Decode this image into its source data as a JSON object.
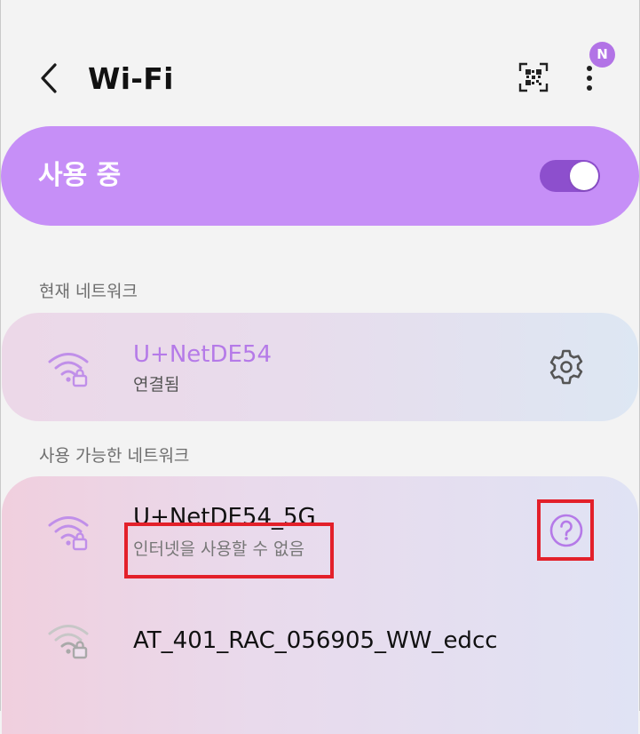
{
  "header": {
    "title": "Wi-Fi",
    "back_icon": "chevron-left-icon",
    "qr_icon": "qr-code-scan-icon",
    "more_icon": "more-vertical-icon",
    "avatar_initial": "N",
    "avatar_color": "#b273e6"
  },
  "master_toggle": {
    "label": "사용 중",
    "state": "on",
    "card_color": "#c68ff7",
    "track_color": "#8d4fcd"
  },
  "current_network": {
    "section_label": "현재 네트워크",
    "name": "U+NetDE54",
    "status": "연결됨",
    "name_color": "#b57ae8",
    "action_icon": "gear-icon"
  },
  "available_networks": {
    "section_label": "사용 가능한 네트워크",
    "items": [
      {
        "name": "U+NetDE54_5G",
        "status": "인터넷을 사용할 수 없음",
        "action_icon": "question-circle-icon"
      },
      {
        "name": "AT_401_RAC_056905_WW_edcc",
        "status": ""
      }
    ]
  },
  "colors": {
    "accent": "#b57ae8",
    "highlight": "#e3202a"
  }
}
